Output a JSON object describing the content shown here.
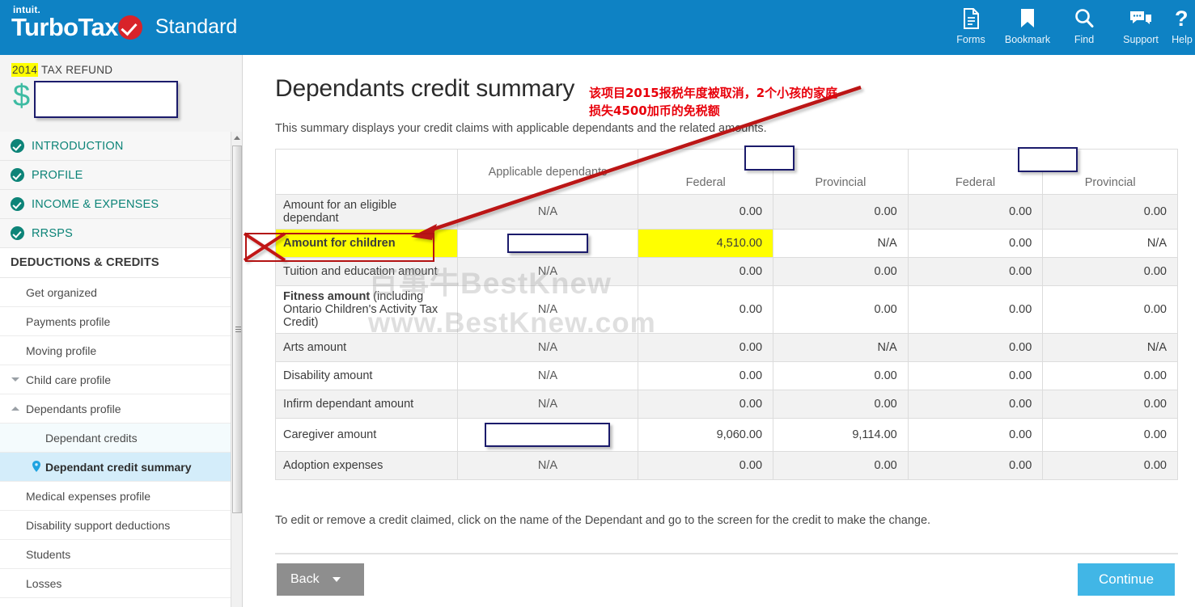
{
  "topbar": {
    "brand_intuit": "intuit.",
    "brand_name": "TurboTax",
    "brand_edition": "Standard",
    "tools": [
      {
        "label": "Forms",
        "icon": "document-icon"
      },
      {
        "label": "Bookmark",
        "icon": "bookmark-icon"
      },
      {
        "label": "Find",
        "icon": "search-icon"
      },
      {
        "label": "Support",
        "icon": "chat-bubble-icon"
      },
      {
        "label": "Help",
        "icon": "question-mark-icon"
      }
    ],
    "bg_color": "#0e82c4"
  },
  "sidebar": {
    "refund": {
      "year": "2014",
      "label": "TAX REFUND",
      "currency_symbol": "$",
      "value": "",
      "redacted": true
    },
    "major_items": [
      {
        "label": "INTRODUCTION",
        "complete": true
      },
      {
        "label": "PROFILE",
        "complete": true
      },
      {
        "label": "INCOME & EXPENSES",
        "complete": true
      },
      {
        "label": "RRSPS",
        "complete": true
      }
    ],
    "section_header": "DEDUCTIONS & CREDITS",
    "items": [
      {
        "label": "Get organized",
        "type": "item"
      },
      {
        "label": "Payments profile",
        "type": "item"
      },
      {
        "label": "Moving profile",
        "type": "item"
      },
      {
        "label": "Child care profile",
        "type": "item",
        "caret": "down"
      },
      {
        "label": "Dependants profile",
        "type": "item",
        "caret": "up"
      },
      {
        "label": "Dependant credits",
        "type": "sub"
      },
      {
        "label": "Dependant credit summary",
        "type": "active",
        "icon": "location-pin-icon"
      },
      {
        "label": "Medical expenses profile",
        "type": "item"
      },
      {
        "label": "Disability support deductions",
        "type": "item"
      },
      {
        "label": "Students",
        "type": "item"
      },
      {
        "label": "Losses",
        "type": "item"
      }
    ],
    "accent_color": "#0d8478",
    "active_bg": "#d4edfa"
  },
  "main": {
    "title": "Dependants credit summary",
    "subtitle": "This summary displays your credit claims with applicable dependants and the related amounts.",
    "footer_note": "To edit or remove a credit claimed, click on the name of the Dependant and go to the screen for the credit to make the change.",
    "back_label": "Back",
    "continue_label": "Continue",
    "continue_color": "#41b6e6"
  },
  "table": {
    "headers": {
      "label_col": "",
      "dependants_col": "Applicable dependants",
      "group1": {
        "federal": "Federal",
        "provincial": "Provincial"
      },
      "group2": {
        "federal": "Federal",
        "provincial": "Provincial"
      }
    },
    "rows": [
      {
        "label": "Amount for an eligible dependant",
        "dependants": "N/A",
        "values": [
          "0.00",
          "0.00",
          "0.00",
          "0.00"
        ],
        "alt": true
      },
      {
        "label": "Amount for children",
        "dependants": "",
        "dependants_redacted": true,
        "values": [
          "4,510.00",
          "N/A",
          "0.00",
          "N/A"
        ],
        "alt": false,
        "label_highlight": true,
        "value_highlight_index": 0
      },
      {
        "label": "Tuition and education amount",
        "dependants": "N/A",
        "values": [
          "0.00",
          "0.00",
          "0.00",
          "0.00"
        ],
        "alt": true
      },
      {
        "label": "Fitness amount (including Ontario Children's Activity Tax Credit)",
        "label_bold_part": "Fitness amount",
        "label_rest": " (including Ontario Children's Activity Tax Credit)",
        "dependants": "N/A",
        "values": [
          "0.00",
          "0.00",
          "0.00",
          "0.00"
        ],
        "alt": false
      },
      {
        "label": "Arts amount",
        "dependants": "N/A",
        "values": [
          "0.00",
          "N/A",
          "0.00",
          "N/A"
        ],
        "alt": true
      },
      {
        "label": "Disability amount",
        "dependants": "N/A",
        "values": [
          "0.00",
          "0.00",
          "0.00",
          "0.00"
        ],
        "alt": false
      },
      {
        "label": "Infirm dependant amount",
        "dependants": "N/A",
        "values": [
          "0.00",
          "0.00",
          "0.00",
          "0.00"
        ],
        "alt": true
      },
      {
        "label": "Caregiver amount",
        "dependants": "",
        "dependants_redacted": true,
        "dependants_redact_wide": true,
        "values": [
          "9,060.00",
          "9,114.00",
          "0.00",
          "0.00"
        ],
        "alt": false
      },
      {
        "label": "Adoption expenses",
        "dependants": "N/A",
        "values": [
          "0.00",
          "0.00",
          "0.00",
          "0.00"
        ],
        "alt": true
      }
    ]
  },
  "annotations": {
    "chinese_note_line1": "该项目2015报税年度被取消，2个小孩的家庭",
    "chinese_note_line2": "损失4500加币的免税额",
    "note_color": "#e8000b",
    "arrow": "red-arrow-pointing-to-amount-for-children",
    "cross_out": "red-x-over-amount-for-children",
    "highlight_color": "#ffff00"
  },
  "watermark": {
    "line1": "百事牛BestKnew",
    "line2": "www.BestKnew.com"
  }
}
